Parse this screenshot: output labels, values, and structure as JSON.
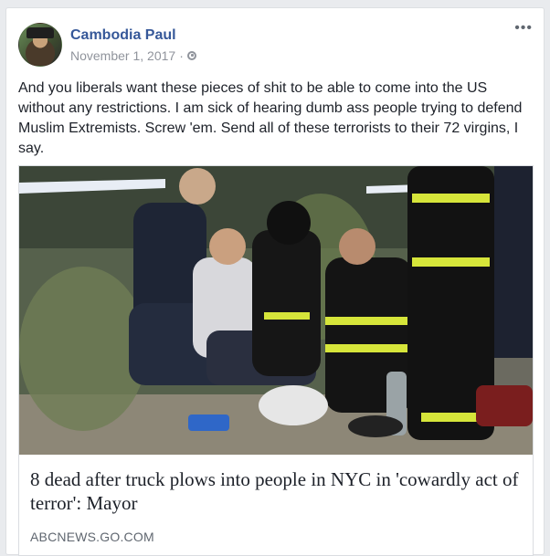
{
  "post": {
    "author": "Cambodia Paul",
    "date": "November 1, 2017",
    "separator": "·",
    "privacy_icon": "globe-icon",
    "more_icon": "ellipsis-icon",
    "more_label": "•••",
    "text": "And you liberals want these pieces of shit to be able to come into the US without any restrictions. I am sick of hearing dumb ass people trying to defend Muslim Extremists. Screw 'em. Send all of these terrorists to their 72 virgins, I say."
  },
  "link_preview": {
    "headline": "8 dead after truck plows into people in NYC in 'cowardly act of terror': Mayor",
    "domain": "ABCNEWS.GO.COM",
    "image": "news-photo"
  },
  "colors": {
    "author_link": "#365899",
    "meta_text": "#90949c",
    "body_text": "#1d2129",
    "page_bg": "#e9ebee"
  }
}
